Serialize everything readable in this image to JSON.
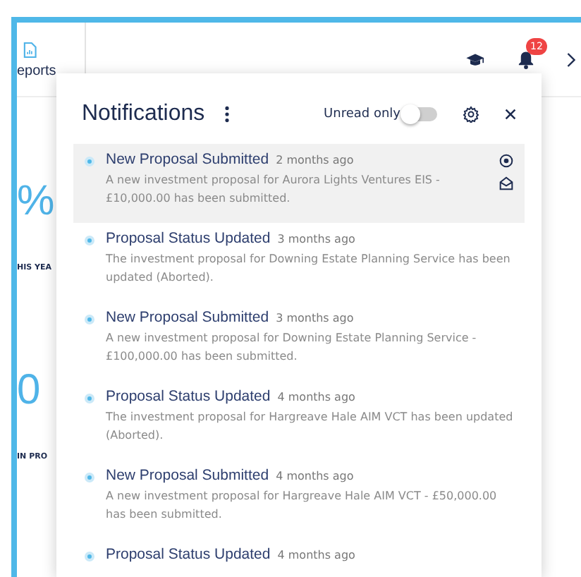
{
  "top_bar": {
    "nav_label": "eports",
    "badge": "12"
  },
  "background": {
    "stats": [
      {
        "value": "%",
        "caption": "HIS YEA"
      },
      {
        "value": "0",
        "caption": "IN PRO"
      }
    ]
  },
  "notifications": {
    "title": "Notifications",
    "unread_only": {
      "label": "Unread only",
      "on": false
    },
    "items": [
      {
        "title": "New Proposal Submitted",
        "time": "2 months ago",
        "body": "A new investment proposal for Aurora Lights Ventures EIS - £10,000.00 has been submitted.",
        "selected": true,
        "unread": true
      },
      {
        "title": "Proposal Status Updated",
        "time": "3 months ago",
        "body": "The investment proposal for Downing Estate Planning Service has been updated (Aborted).",
        "selected": false,
        "unread": true
      },
      {
        "title": "New Proposal Submitted",
        "time": "3 months ago",
        "body": "A new investment proposal for Downing Estate Planning Service - £100,000.00 has been submitted.",
        "selected": false,
        "unread": true
      },
      {
        "title": "Proposal Status Updated",
        "time": "4 months ago",
        "body": "The investment proposal for Hargreave Hale AIM VCT has been updated (Aborted).",
        "selected": false,
        "unread": true
      },
      {
        "title": "New Proposal Submitted",
        "time": "4 months ago",
        "body": "A new investment proposal for Hargreave Hale AIM VCT - £50,000.00 has been submitted.",
        "selected": false,
        "unread": true
      },
      {
        "title": "Proposal Status Updated",
        "time": "4 months ago",
        "selected": false,
        "unread": true
      }
    ]
  }
}
